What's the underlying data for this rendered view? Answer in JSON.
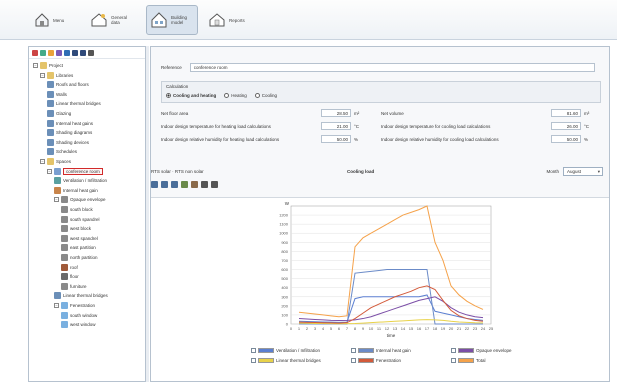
{
  "toolbar": {
    "buttons": [
      {
        "label": "Menu"
      },
      {
        "label": "General data"
      },
      {
        "label": "Building model"
      },
      {
        "label": "Reports"
      }
    ]
  },
  "tree": {
    "nodes": [
      {
        "label": "Project",
        "icon": "folder-icon"
      },
      {
        "label": "Libraries",
        "icon": "folder-icon"
      },
      {
        "label": "Roofs and floors",
        "icon": "list-icon"
      },
      {
        "label": "Walls",
        "icon": "list-icon"
      },
      {
        "label": "Linear thermal bridges",
        "icon": "list-icon"
      },
      {
        "label": "Glazing",
        "icon": "list-icon"
      },
      {
        "label": "Internal heat gains",
        "icon": "list-icon"
      },
      {
        "label": "Shading diagrams",
        "icon": "list-icon"
      },
      {
        "label": "Shading devices",
        "icon": "list-icon"
      },
      {
        "label": "Schedules",
        "icon": "list-icon"
      },
      {
        "label": "Spaces",
        "icon": "folder-icon"
      },
      {
        "label": "conference room",
        "icon": "room-icon"
      },
      {
        "label": "Ventilation / Infiltration",
        "icon": "fan-icon"
      },
      {
        "label": "Internal heat gain",
        "icon": "person-icon"
      },
      {
        "label": "Opaque envelope",
        "icon": "wall-icon"
      },
      {
        "label": "south block",
        "icon": "wall-icon"
      },
      {
        "label": "south spandrel",
        "icon": "wall-icon"
      },
      {
        "label": "west block",
        "icon": "wall-icon"
      },
      {
        "label": "west spandrel",
        "icon": "wall-icon"
      },
      {
        "label": "east partition",
        "icon": "wall-icon"
      },
      {
        "label": "north partition",
        "icon": "wall-icon"
      },
      {
        "label": "roof",
        "icon": "roof-icon"
      },
      {
        "label": "floor",
        "icon": "floor-icon"
      },
      {
        "label": "furniture",
        "icon": "wall-icon"
      },
      {
        "label": "Linear thermal bridges",
        "icon": "list-icon"
      },
      {
        "label": "Fenestration",
        "icon": "window-icon"
      },
      {
        "label": "south window",
        "icon": "window-icon"
      },
      {
        "label": "west window",
        "icon": "window-icon"
      }
    ]
  },
  "main": {
    "reference_label": "Reference",
    "reference_value": "conference room",
    "calc_group_title": "Calculation",
    "calc_options": [
      "Cooling and heating",
      "Heating",
      "Cooling"
    ],
    "fields_left": [
      {
        "label": "Net floor area",
        "value": "28.50",
        "unit": "m²"
      },
      {
        "label": "Indoor design temperature for heating load calculations",
        "value": "21.00",
        "unit": "°C"
      },
      {
        "label": "Indoor design relative humidity for heating load calculations",
        "value": "50.00",
        "unit": "%"
      }
    ],
    "fields_right": [
      {
        "label": "Net volume",
        "value": "81.60",
        "unit": "m³"
      },
      {
        "label": "Indoor design temperature for cooling load calculations",
        "value": "26.00",
        "unit": "°C"
      },
      {
        "label": "Indoor design relative humidity for cooling load calculations",
        "value": "50.00",
        "unit": "%"
      }
    ],
    "chart_toggle": "RTS solar · RTS non solar",
    "chart_mode": "Cooling load",
    "month_label": "Month",
    "month_value": "August"
  },
  "chart_data": {
    "type": "line",
    "title": "",
    "xlabel": "time",
    "ylabel": "W",
    "x": [
      1,
      2,
      3,
      4,
      5,
      6,
      7,
      8,
      9,
      10,
      11,
      12,
      13,
      14,
      15,
      16,
      17,
      18,
      19,
      20,
      21,
      22,
      23,
      24
    ],
    "xlim": [
      0,
      25
    ],
    "ylim": [
      0,
      1300
    ],
    "yticks": [
      0,
      100,
      200,
      300,
      400,
      500,
      600,
      700,
      800,
      900,
      1000,
      1100,
      1200
    ],
    "grid": true,
    "legend_position": "bottom",
    "series": [
      {
        "name": "Ventilation / Infiltration",
        "color": "#5b7fd1",
        "values": [
          30,
          28,
          25,
          22,
          20,
          18,
          20,
          280,
          300,
          300,
          300,
          300,
          300,
          300,
          300,
          300,
          320,
          140,
          120,
          100,
          80,
          60,
          50,
          40
        ]
      },
      {
        "name": "Internal heat gain",
        "color": "#6b8bc8",
        "values": [
          0,
          0,
          0,
          0,
          0,
          0,
          0,
          560,
          570,
          580,
          590,
          600,
          600,
          600,
          600,
          600,
          600,
          0,
          0,
          0,
          0,
          0,
          0,
          0
        ]
      },
      {
        "name": "Opaque envelope",
        "color": "#7b4ea6",
        "values": [
          60,
          55,
          50,
          45,
          40,
          38,
          40,
          45,
          60,
          80,
          110,
          140,
          170,
          200,
          230,
          260,
          280,
          300,
          250,
          180,
          130,
          100,
          80,
          70
        ]
      },
      {
        "name": "Linear thermal bridges",
        "color": "#e8d24a",
        "values": [
          10,
          8,
          6,
          5,
          4,
          3,
          4,
          6,
          10,
          15,
          20,
          25,
          30,
          35,
          40,
          45,
          48,
          46,
          40,
          30,
          22,
          18,
          14,
          12
        ]
      },
      {
        "name": "Fenestration",
        "color": "#d35a3a",
        "values": [
          20,
          18,
          16,
          14,
          12,
          10,
          15,
          60,
          120,
          180,
          220,
          260,
          300,
          330,
          360,
          400,
          420,
          380,
          260,
          150,
          90,
          60,
          40,
          30
        ]
      },
      {
        "name": "Total",
        "color": "#f5a24a",
        "values": [
          130,
          120,
          110,
          100,
          90,
          80,
          90,
          850,
          950,
          1000,
          1050,
          1100,
          1150,
          1200,
          1230,
          1260,
          1300,
          900,
          700,
          420,
          320,
          250,
          200,
          160
        ]
      }
    ]
  }
}
